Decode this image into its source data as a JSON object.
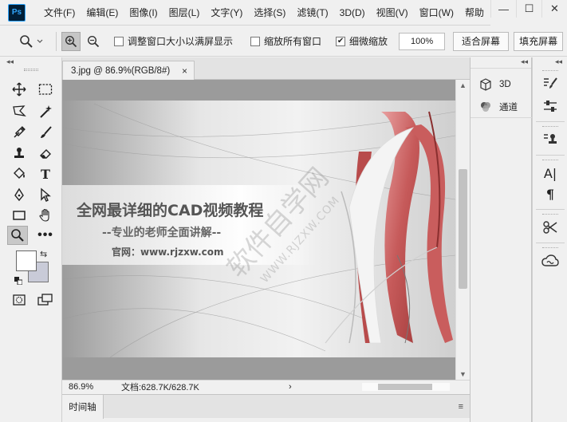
{
  "app": {
    "logo_text": "Ps",
    "menu": [
      "文件(F)",
      "编辑(E)",
      "图像(I)",
      "图层(L)",
      "文字(Y)",
      "选择(S)",
      "滤镜(T)",
      "3D(D)",
      "视图(V)",
      "窗口(W)",
      "帮助"
    ],
    "window_controls": {
      "minimize": "—",
      "maximize": "☐",
      "close": "✕"
    }
  },
  "options_bar": {
    "zoom_tool_icon": "zoom-magnifier-icon",
    "zoom_in_icon": "zoom-in-icon",
    "zoom_out_icon": "zoom-out-icon",
    "resize_windows_label": "调整窗口大小以满屏显示",
    "resize_windows_checked": false,
    "zoom_all_label": "缩放所有窗口",
    "zoom_all_checked": false,
    "scrubby_label": "细微缩放",
    "scrubby_checked": true,
    "zoom_percent": "100%",
    "fit_screen_label": "适合屏幕",
    "fill_screen_label": "填充屏幕"
  },
  "document": {
    "tab_title": "3.jpg @ 86.9%(RGB/8#)",
    "tab_close": "×",
    "canvas": {
      "headline": "全网最详细的CAD视频教程",
      "subheadline": "--专业的老师全面讲解--",
      "website": "官网：www.rjzxw.com",
      "watermark_cn": "软件自学网",
      "watermark_url": "WWW.RJZXW.COM"
    }
  },
  "status_bar": {
    "zoom": "86.9%",
    "doc_info": "文档:628.7K/628.7K",
    "arrow": "›"
  },
  "timeline": {
    "tab_label": "时间轴",
    "menu_icon": "≡"
  },
  "mid_panel": {
    "items": [
      {
        "label": "3D",
        "icon": "3d-cube-icon"
      },
      {
        "label": "通道",
        "icon": "channels-icon"
      }
    ]
  },
  "colors": {
    "foreground": "#ffffff",
    "background": "#c9cbd8",
    "ps_logo_bg": "#001e36",
    "ps_logo_fg": "#31a8ff"
  }
}
